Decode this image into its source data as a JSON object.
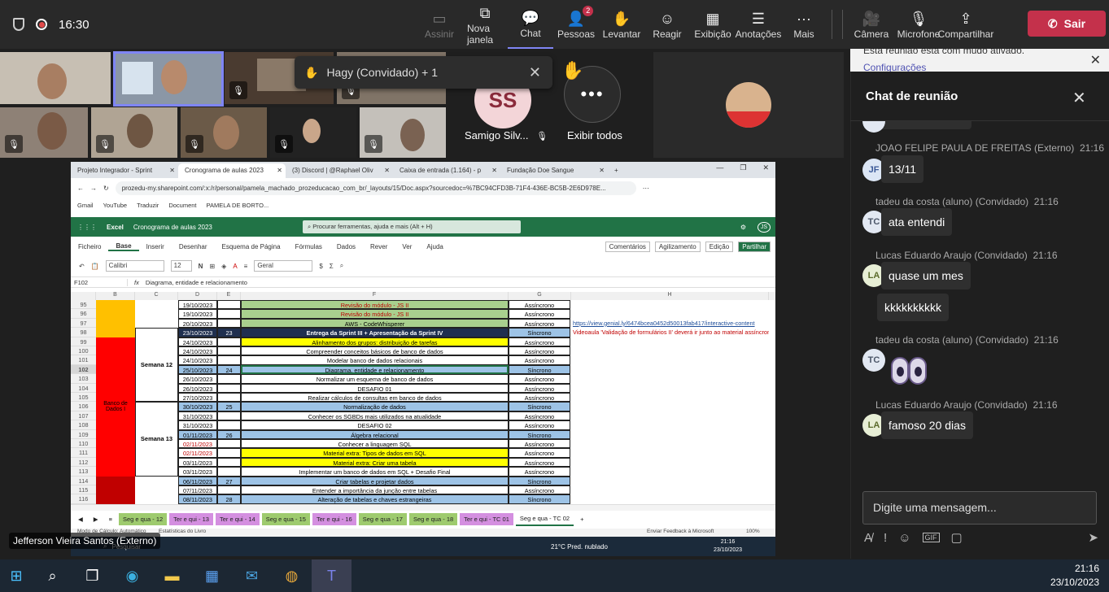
{
  "top_bar": {
    "time": "16:30",
    "buttons": [
      {
        "label": "Assinir",
        "icon": "share-screen-icon",
        "disabled": true
      },
      {
        "label": "Nova janela",
        "icon": "new-window-icon"
      },
      {
        "label": "Chat",
        "icon": "chat-icon",
        "active": true
      },
      {
        "label": "Pessoas",
        "icon": "people-icon",
        "badge": "2"
      },
      {
        "label": "Levantar",
        "icon": "raise-hand-icon"
      },
      {
        "label": "Reagir",
        "icon": "react-icon"
      },
      {
        "label": "Exibição",
        "icon": "view-icon"
      },
      {
        "label": "Anotações",
        "icon": "notes-icon"
      },
      {
        "label": "Mais",
        "icon": "more-icon"
      },
      {
        "label": "Câmera",
        "icon": "camera-off-icon"
      },
      {
        "label": "Microfone",
        "icon": "mic-off-icon"
      },
      {
        "label": "Compartilhar",
        "icon": "share-icon"
      }
    ],
    "leave_label": "Sair"
  },
  "participants": {
    "toast": "Hagy (Convidado) + 1",
    "avatar_initials": "SS",
    "avatar_name": "Samigo Silv...",
    "show_all": "Exibir todos"
  },
  "presenter_label": "Jefferson Vieira Santos (Externo)",
  "chat": {
    "notice_line1": "Esta reunião está com mudo ativado.",
    "notice_line2": "Configurações",
    "title": "Chat de reunião",
    "messages": [
      {
        "sender": "JOAO FELIPE PAULA DE FREITAS (Externo)",
        "time": "21:16",
        "initials": "JF",
        "text": "13/11"
      },
      {
        "sender": "tadeu da costa (aluno) (Convidado)",
        "time": "21:16",
        "initials": "TC",
        "text": "ata entendi"
      },
      {
        "sender": "Lucas Eduardo Araujo (Convidado)",
        "time": "21:16",
        "initials": "LA",
        "text": "quase um mes"
      },
      {
        "sender": "",
        "time": "",
        "initials": "",
        "text": "kkkkkkkkkk"
      },
      {
        "sender": "tadeu da costa (aluno) (Convidado)",
        "time": "21:16",
        "initials": "TC",
        "text": ""
      },
      {
        "sender": "Lucas Eduardo Araujo (Convidado)",
        "time": "21:16",
        "initials": "LA",
        "text": "famoso 20 dias"
      }
    ],
    "compose_placeholder": "Digite uma mensagem..."
  },
  "browser": {
    "tabs": [
      "Projeto Integrador - Sprint",
      "Cronograma de aulas 2023",
      "(3) Discord | @Raphael Oliv",
      "Caixa de entrada (1.164) - p",
      "Fundação Doe Sangue"
    ],
    "url": "prozedu-my.sharepoint.com/:x:/r/personal/pamela_machado_prozeducacao_com_br/_layouts/15/Doc.aspx?sourcedoc=%7BC94CFD3B-71F4-436E-BC5B-2E6D978E...",
    "bookmarks": [
      "Gmail",
      "YouTube",
      "Traduzir",
      "Document",
      "PAMELA DE BORTO..."
    ]
  },
  "excel": {
    "app": "Excel",
    "doc_title": "Cronograma de aulas 2023",
    "search_placeholder": "Procurar ferramentas, ajuda e mais (Alt + H)",
    "menu": [
      "Ficheiro",
      "Base",
      "Inserir",
      "Desenhar",
      "Esquema de Página",
      "Fórmulas",
      "Dados",
      "Rever",
      "Ver",
      "Ajuda"
    ],
    "menu_right": [
      "Comentários",
      "Agilizamento",
      "Edição",
      "Partilhar"
    ],
    "font": "Calibri",
    "font_size": "12",
    "number_format": "Geral",
    "cell_ref": "F102",
    "formula": "Diagrama, entidade e relacionamento",
    "columns": [
      "B",
      "C",
      "D",
      "E",
      "F",
      "G",
      "H"
    ],
    "rows": [
      {
        "n": "95",
        "date": "19/10/2023",
        "num": "",
        "activity": "Revisão do módulo - JS II",
        "type": "Assíncrono",
        "fill": "#a9d08e",
        "color": "#c00000",
        "link": ""
      },
      {
        "n": "96",
        "date": "19/10/2023",
        "num": "",
        "activity": "Revisão do módulo - JS II",
        "type": "Assíncrono",
        "fill": "#a9d08e",
        "color": "#c00000",
        "link": ""
      },
      {
        "n": "97",
        "date": "20/10/2023",
        "num": "",
        "activity": "AWS - CodeWhisperer",
        "type": "Assíncrono",
        "fill": "#a9d08e",
        "color": "#000",
        "link": "https://view.genial.ly/6474bcea0452d50013fab417/interactive-content"
      },
      {
        "n": "98",
        "date": "23/10/2023",
        "num": "23",
        "activity": "Entrega da Sprint III + Apresentação da Sprint IV",
        "type": "Síncrono",
        "fill": "#1f2f4f",
        "color": "#fff",
        "link": "Videoaula 'Validação de formulários II' deverá ir junto ao material assíncrono"
      },
      {
        "n": "99",
        "date": "24/10/2023",
        "num": "",
        "activity": "Alinhamento dos grupos: distribuição de tarefas",
        "type": "Assíncrono",
        "fill": "#ffff00",
        "color": "#000",
        "link": ""
      },
      {
        "n": "100",
        "date": "24/10/2023",
        "num": "",
        "activity": "Compreender conceitos básicos de banco de dados",
        "type": "Assíncrono",
        "fill": "#fff",
        "color": "#000",
        "link": ""
      },
      {
        "n": "101",
        "date": "24/10/2023",
        "num": "",
        "activity": "Modelar banco de dados relacionais",
        "type": "Assíncrono",
        "fill": "#fff",
        "color": "#000",
        "link": ""
      },
      {
        "n": "102",
        "date": "25/10/2023",
        "num": "24",
        "activity": "Diagrama, entidade e relacionamento",
        "type": "Síncrono",
        "fill": "#9dc3e6",
        "color": "#000",
        "link": ""
      },
      {
        "n": "103",
        "date": "26/10/2023",
        "num": "",
        "activity": "Normalizar um esquema de banco de dados",
        "type": "Assíncrono",
        "fill": "#fff",
        "color": "#000",
        "link": ""
      },
      {
        "n": "104",
        "date": "26/10/2023",
        "num": "",
        "activity": "DESAFIO 01",
        "type": "Assíncrono",
        "fill": "#fff",
        "color": "#000",
        "link": ""
      },
      {
        "n": "105",
        "date": "27/10/2023",
        "num": "",
        "activity": "Realizar cálculos de consultas em banco de dados",
        "type": "Assíncrono",
        "fill": "#fff",
        "color": "#000",
        "link": ""
      },
      {
        "n": "106",
        "date": "30/10/2023",
        "num": "25",
        "activity": "Normalização de dados",
        "type": "Síncrono",
        "fill": "#9dc3e6",
        "color": "#000",
        "link": ""
      },
      {
        "n": "107",
        "date": "31/10/2023",
        "num": "",
        "activity": "Conhecer os SGBDs mais utilizados na atualidade",
        "type": "Assíncrono",
        "fill": "#fff",
        "color": "#000",
        "link": ""
      },
      {
        "n": "108",
        "date": "31/10/2023",
        "num": "",
        "activity": "DESAFIO 02",
        "type": "Assíncrono",
        "fill": "#fff",
        "color": "#000",
        "link": ""
      },
      {
        "n": "109",
        "date": "01/11/2023",
        "num": "26",
        "activity": "Álgebra relacional",
        "type": "Síncrono",
        "fill": "#9dc3e6",
        "color": "#000",
        "link": ""
      },
      {
        "n": "110",
        "date": "02/11/2023",
        "num": "",
        "activity": "Conhecer a linguagem SQL",
        "type": "Assíncrono",
        "fill": "#fff",
        "color": "#000",
        "link": "",
        "datecolor": "#c00000"
      },
      {
        "n": "111",
        "date": "02/11/2023",
        "num": "",
        "activity": "Material extra: Tipos de dados em SQL",
        "type": "Assíncrono",
        "fill": "#ffff00",
        "color": "#000",
        "link": "",
        "datecolor": "#c00000"
      },
      {
        "n": "112",
        "date": "03/11/2023",
        "num": "",
        "activity": "Material extra: Criar uma tabela",
        "type": "Assíncrono",
        "fill": "#ffff00",
        "color": "#000",
        "link": ""
      },
      {
        "n": "113",
        "date": "03/11/2023",
        "num": "",
        "activity": "Implementar um banco de dados em SQL + Desafio Final",
        "type": "Assíncrono",
        "fill": "#fff",
        "color": "#000",
        "link": ""
      },
      {
        "n": "114",
        "date": "06/11/2023",
        "num": "27",
        "activity": "Criar tabelas e projetar dados",
        "type": "Síncrono",
        "fill": "#9dc3e6",
        "color": "#000",
        "link": ""
      },
      {
        "n": "115",
        "date": "07/11/2023",
        "num": "",
        "activity": "Entender a importância da junção entre tabelas",
        "type": "Assíncrono",
        "fill": "#fff",
        "color": "#000",
        "link": ""
      },
      {
        "n": "116",
        "date": "08/11/2023",
        "num": "28",
        "activity": "Alteração de tabelas e chaves estrangeiras",
        "type": "Síncrono",
        "fill": "#9dc3e6",
        "color": "#000",
        "link": ""
      }
    ],
    "modules": [
      {
        "label": "Banco de Dados I"
      }
    ],
    "weeks": [
      {
        "label": "Semana 12"
      },
      {
        "label": "Semana 13"
      }
    ],
    "sheet_tabs": [
      {
        "label": "Seg e qua - 12",
        "kind": "g"
      },
      {
        "label": "Ter e qui - 13",
        "kind": "p"
      },
      {
        "label": "Ter e qui - 14",
        "kind": "p"
      },
      {
        "label": "Seg e qua - 15",
        "kind": "g"
      },
      {
        "label": "Ter e qui - 16",
        "kind": "p"
      },
      {
        "label": "Seg e qua - 17",
        "kind": "g"
      },
      {
        "label": "Seg e qua - 18",
        "kind": "g"
      },
      {
        "label": "Ter e qui - TC 01",
        "kind": "p"
      },
      {
        "label": "Seg e qua - TC 02",
        "kind": "w"
      }
    ],
    "status_left": "Modo de Cálculo: Automático",
    "status_stats": "Estatísticas do Livro",
    "status_feedback": "Enviar Feedback à Microsoft",
    "zoom": "100%"
  },
  "inner_taskbar": {
    "search": "Pesquisar",
    "weather": "21°C Pred. nublado",
    "time": "21:16",
    "date": "23/10/2023"
  },
  "taskbar": {
    "time": "21:16",
    "date": "23/10/2023"
  }
}
